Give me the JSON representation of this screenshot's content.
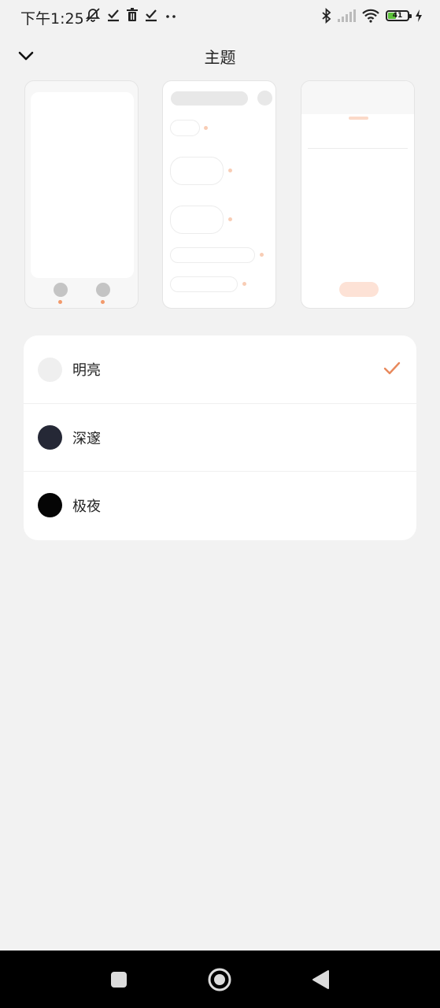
{
  "status_bar": {
    "time": "下午1:25",
    "battery": "41"
  },
  "header": {
    "title": "主题"
  },
  "themes": [
    {
      "label": "明亮",
      "swatch": "#efefef",
      "selected": true
    },
    {
      "label": "深邃",
      "swatch": "#252836",
      "selected": false
    },
    {
      "label": "极夜",
      "swatch": "#050505",
      "selected": false
    }
  ],
  "colors": {
    "background": "#f2f2f2",
    "card": "#ffffff",
    "accent": "#e8895c",
    "navbar": "#000000"
  }
}
